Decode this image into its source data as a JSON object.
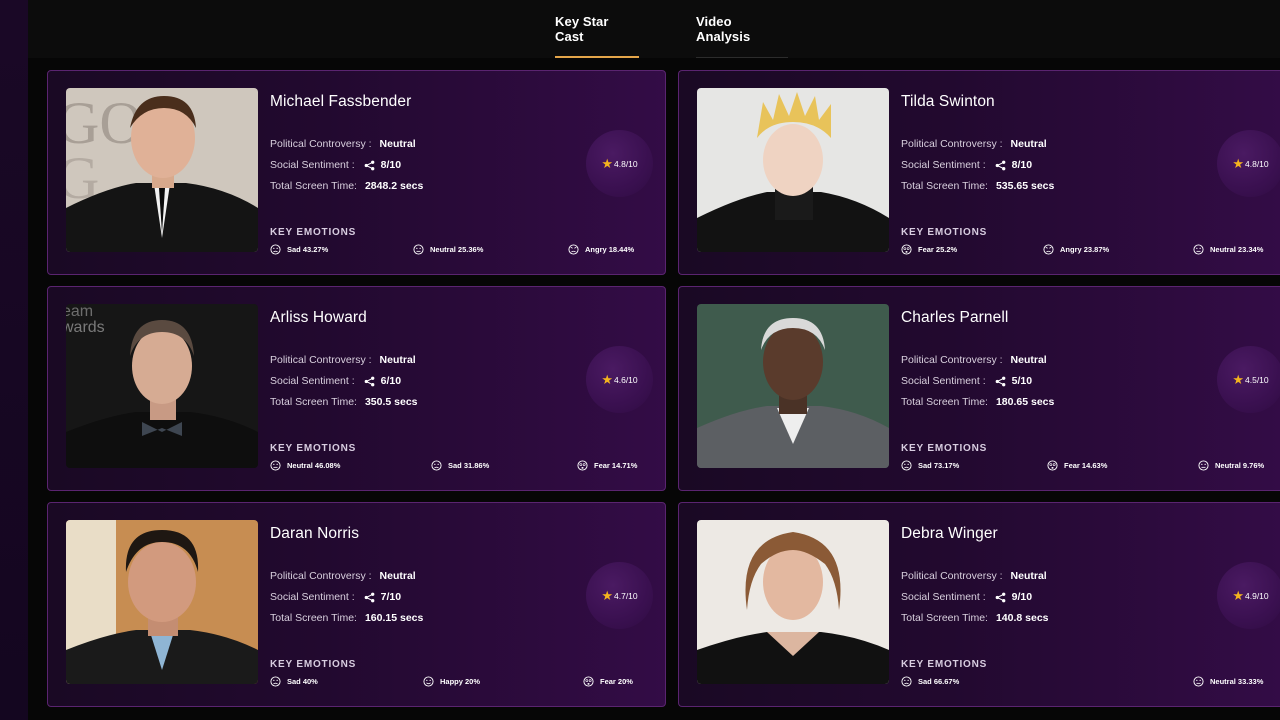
{
  "tabs": [
    {
      "label": "Key Star Cast",
      "active": true
    },
    {
      "label": "Video Analysis",
      "active": false
    }
  ],
  "colors": {
    "accent": "#e3a54a",
    "star": "#f4b41e",
    "card_border": "#5a2470"
  },
  "labels": {
    "political": "Political Controversy :",
    "social": "Social Sentiment :",
    "screen": "Total Screen Time:",
    "key_emotions": "KEY EMOTIONS"
  },
  "cast": [
    {
      "name": "Michael Fassbender",
      "political": "Neutral",
      "social": "8/10",
      "screen_time": "2848.2 secs",
      "rating": "4.8/10",
      "emotions": [
        {
          "label": "Sad 43.27%",
          "icon": "sad-face-icon"
        },
        {
          "label": "Neutral 25.36%",
          "icon": "neutral-face-icon"
        },
        {
          "label": "Angry 18.44%",
          "icon": "angry-face-icon"
        }
      ]
    },
    {
      "name": "Tilda Swinton",
      "political": "Neutral",
      "social": "8/10",
      "screen_time": "535.65 secs",
      "rating": "4.8/10",
      "emotions": [
        {
          "label": "Fear 25.2%",
          "icon": "fear-face-icon"
        },
        {
          "label": "Angry 23.87%",
          "icon": "angry-face-icon"
        },
        {
          "label": "Neutral 23.34%",
          "icon": "neutral-face-icon"
        }
      ]
    },
    {
      "name": "Arliss Howard",
      "political": "Neutral",
      "social": "6/10",
      "screen_time": "350.5 secs",
      "rating": "4.6/10",
      "emotions": [
        {
          "label": "Neutral 46.08%",
          "icon": "neutral-face-icon"
        },
        {
          "label": "Sad 31.86%",
          "icon": "sad-face-icon"
        },
        {
          "label": "Fear 14.71%",
          "icon": "fear-face-icon"
        }
      ]
    },
    {
      "name": "Charles Parnell",
      "political": "Neutral",
      "social": "5/10",
      "screen_time": "180.65 secs",
      "rating": "4.5/10",
      "emotions": [
        {
          "label": "Sad 73.17%",
          "icon": "sad-face-icon"
        },
        {
          "label": "Fear 14.63%",
          "icon": "fear-face-icon"
        },
        {
          "label": "Neutral 9.76%",
          "icon": "neutral-face-icon"
        }
      ]
    },
    {
      "name": "Daran Norris",
      "political": "Neutral",
      "social": "7/10",
      "screen_time": "160.15 secs",
      "rating": "4.7/10",
      "emotions": [
        {
          "label": "Sad 40%",
          "icon": "sad-face-icon"
        },
        {
          "label": "Happy 20%",
          "icon": "happy-face-icon"
        },
        {
          "label": "Fear 20%",
          "icon": "fear-face-icon"
        }
      ]
    },
    {
      "name": "Debra Winger",
      "political": "Neutral",
      "social": "9/10",
      "screen_time": "140.8 secs",
      "rating": "4.9/10",
      "emotions": [
        {
          "label": "Sad 66.67%",
          "icon": "sad-face-icon"
        },
        {
          "label": "Neutral 33.33%",
          "icon": "neutral-face-icon"
        }
      ]
    }
  ]
}
